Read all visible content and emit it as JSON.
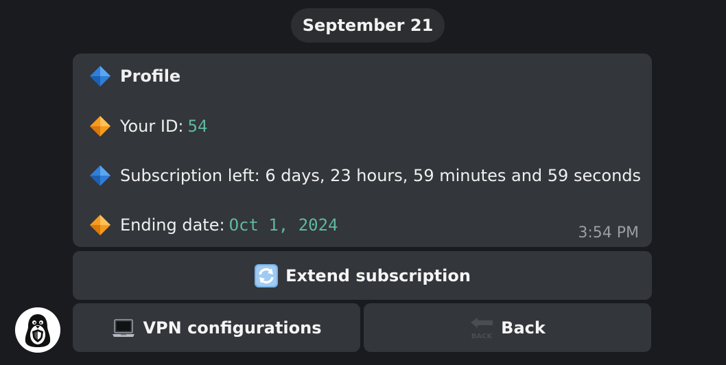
{
  "chat": {
    "date_separator": "September 21"
  },
  "message": {
    "title": "Profile",
    "id_label": "Your ID: ",
    "id_value": "54",
    "subscription_left": "Subscription left: 6 days, 23 hours, 59 minutes and 59 seconds",
    "ending_label": "Ending date: ",
    "ending_value": "Oct 1, 2024",
    "time": "3:54 PM",
    "bullet_icons": [
      "large-blue-diamond-icon",
      "large-orange-diamond-icon"
    ]
  },
  "keyboard": {
    "extend_label": "Extend subscription",
    "vpn_label": "VPN configurations",
    "back_label": "Back",
    "back_icon_text": "BACK"
  },
  "colors": {
    "background": "#1a1b1e",
    "bubble": "#33363b",
    "accent_text": "#5fb8a4",
    "blue_diamond": "#2f7fd8",
    "orange_diamond": "#f79a1e"
  }
}
